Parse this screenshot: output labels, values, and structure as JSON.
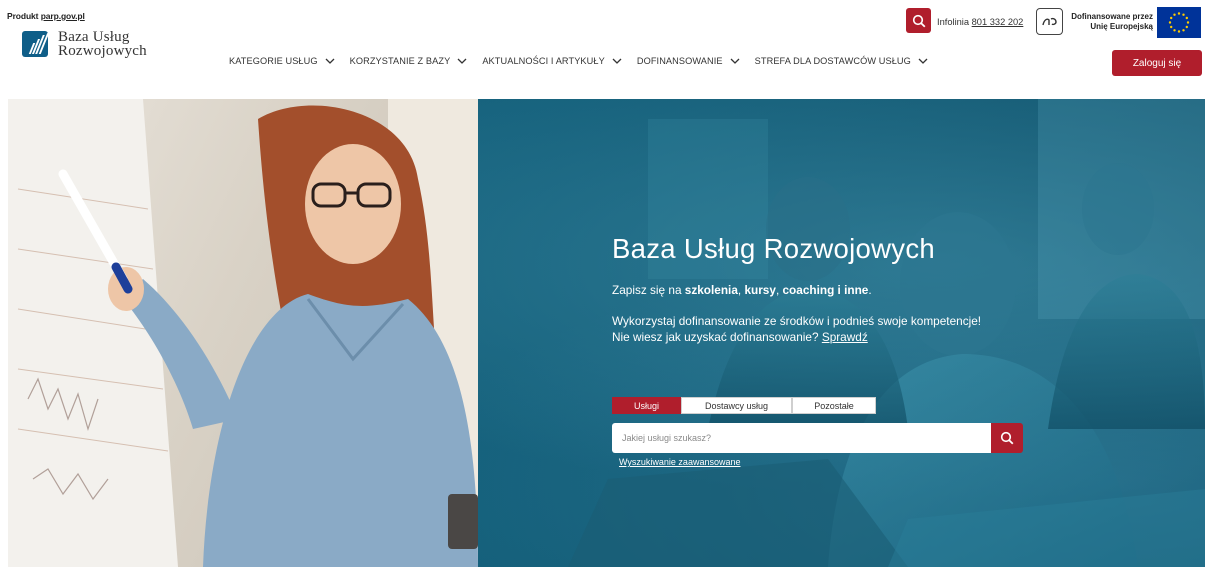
{
  "header": {
    "product_prefix": "Produkt ",
    "product_link": "parp.gov.pl",
    "logo_line1": "Baza Usług",
    "logo_line2": "Rozwojowych",
    "infolinia_label": "Infolinia ",
    "infolinia_number": "801 332 202",
    "sign_language_icon": "sign-language-icon",
    "eu_line1": "Dofinansowane przez",
    "eu_line2": "Unię Europejską",
    "login_label": "Zaloguj się"
  },
  "nav": {
    "items": [
      {
        "label": "KATEGORIE USŁUG"
      },
      {
        "label": "KORZYSTANIE Z BAZY"
      },
      {
        "label": "AKTUALNOŚCI I ARTYKUŁY"
      },
      {
        "label": "DOFINANSOWANIE"
      },
      {
        "label": "STREFA DLA DOSTAWCÓW USŁUG"
      }
    ]
  },
  "hero": {
    "title": "Baza Usług Rozwojowych",
    "line1_prefix": "Zapisz się na ",
    "line1_b1": "szkolenia",
    "line1_sep1": ", ",
    "line1_b2": "kursy",
    "line1_sep2": ", ",
    "line1_b3": "coaching i inne",
    "line1_end": ".",
    "line2": "Wykorzystaj dofinansowanie ze środków i podnieś swoje kompetencje!",
    "line3_prefix": "Nie wiesz jak uzyskać dofinansowanie? ",
    "line3_link": "Sprawdź"
  },
  "search": {
    "tabs": [
      {
        "label": "Usługi",
        "active": true
      },
      {
        "label": "Dostawcy usług",
        "active": false
      },
      {
        "label": "Pozostałe",
        "active": false
      }
    ],
    "placeholder": "Jakiej usługi szukasz?",
    "advanced_label": "Wyszukiwanie zaawansowane"
  },
  "colors": {
    "accent": "#b01e2c",
    "hero_teal": "#145f7a",
    "eu_blue": "#003399",
    "eu_star": "#ffcc00"
  }
}
